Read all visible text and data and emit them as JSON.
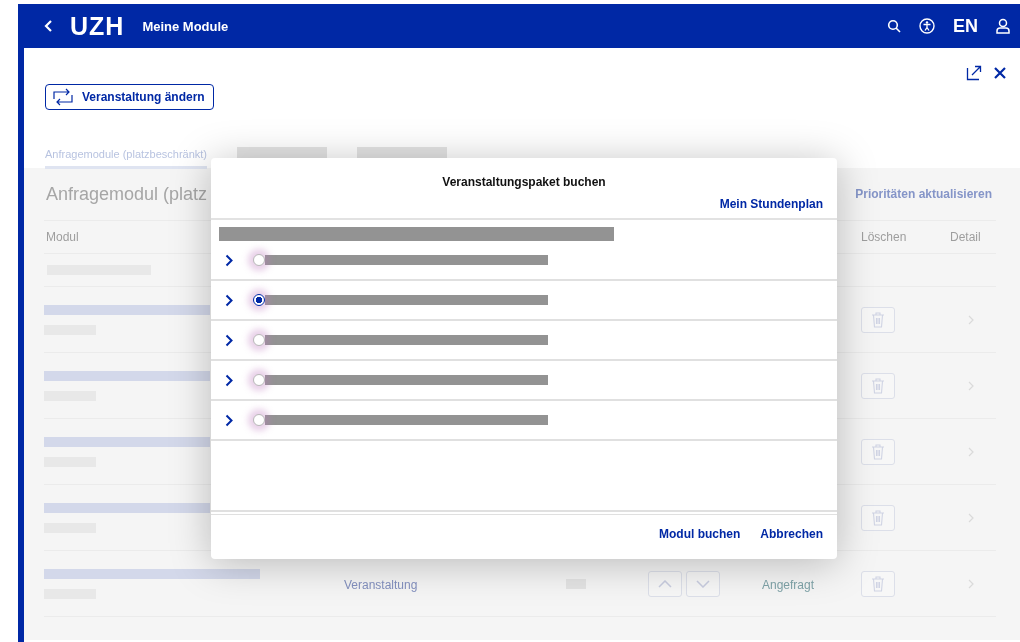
{
  "header": {
    "logo": "UZH",
    "title": "Meine Module",
    "language": "EN"
  },
  "change_button": {
    "label": "Veranstaltung ändern"
  },
  "tabs": [
    {
      "label": "Anfragemodule (platzbeschränkt)",
      "selected": true
    }
  ],
  "panel": {
    "title": "Anfragemodul (platz",
    "priorities_button": "Prioritäten aktualisieren",
    "columns": [
      "Modul",
      "Löschen",
      "Detail"
    ],
    "rows": [
      {
        "kind": "skeleton"
      },
      {
        "kind": "module"
      },
      {
        "kind": "module"
      },
      {
        "kind": "module"
      },
      {
        "kind": "module"
      },
      {
        "kind": "module",
        "type": "Veranstaltung",
        "status": "Angefragt"
      }
    ]
  },
  "dialog": {
    "title": "Veranstaltungspaket buchen",
    "link": "Mein Stundenplan",
    "options": [
      {
        "selected": false
      },
      {
        "selected": true
      },
      {
        "selected": false
      },
      {
        "selected": false
      },
      {
        "selected": false
      }
    ],
    "buttons": [
      "Modul buchen",
      "Abbrechen"
    ]
  }
}
